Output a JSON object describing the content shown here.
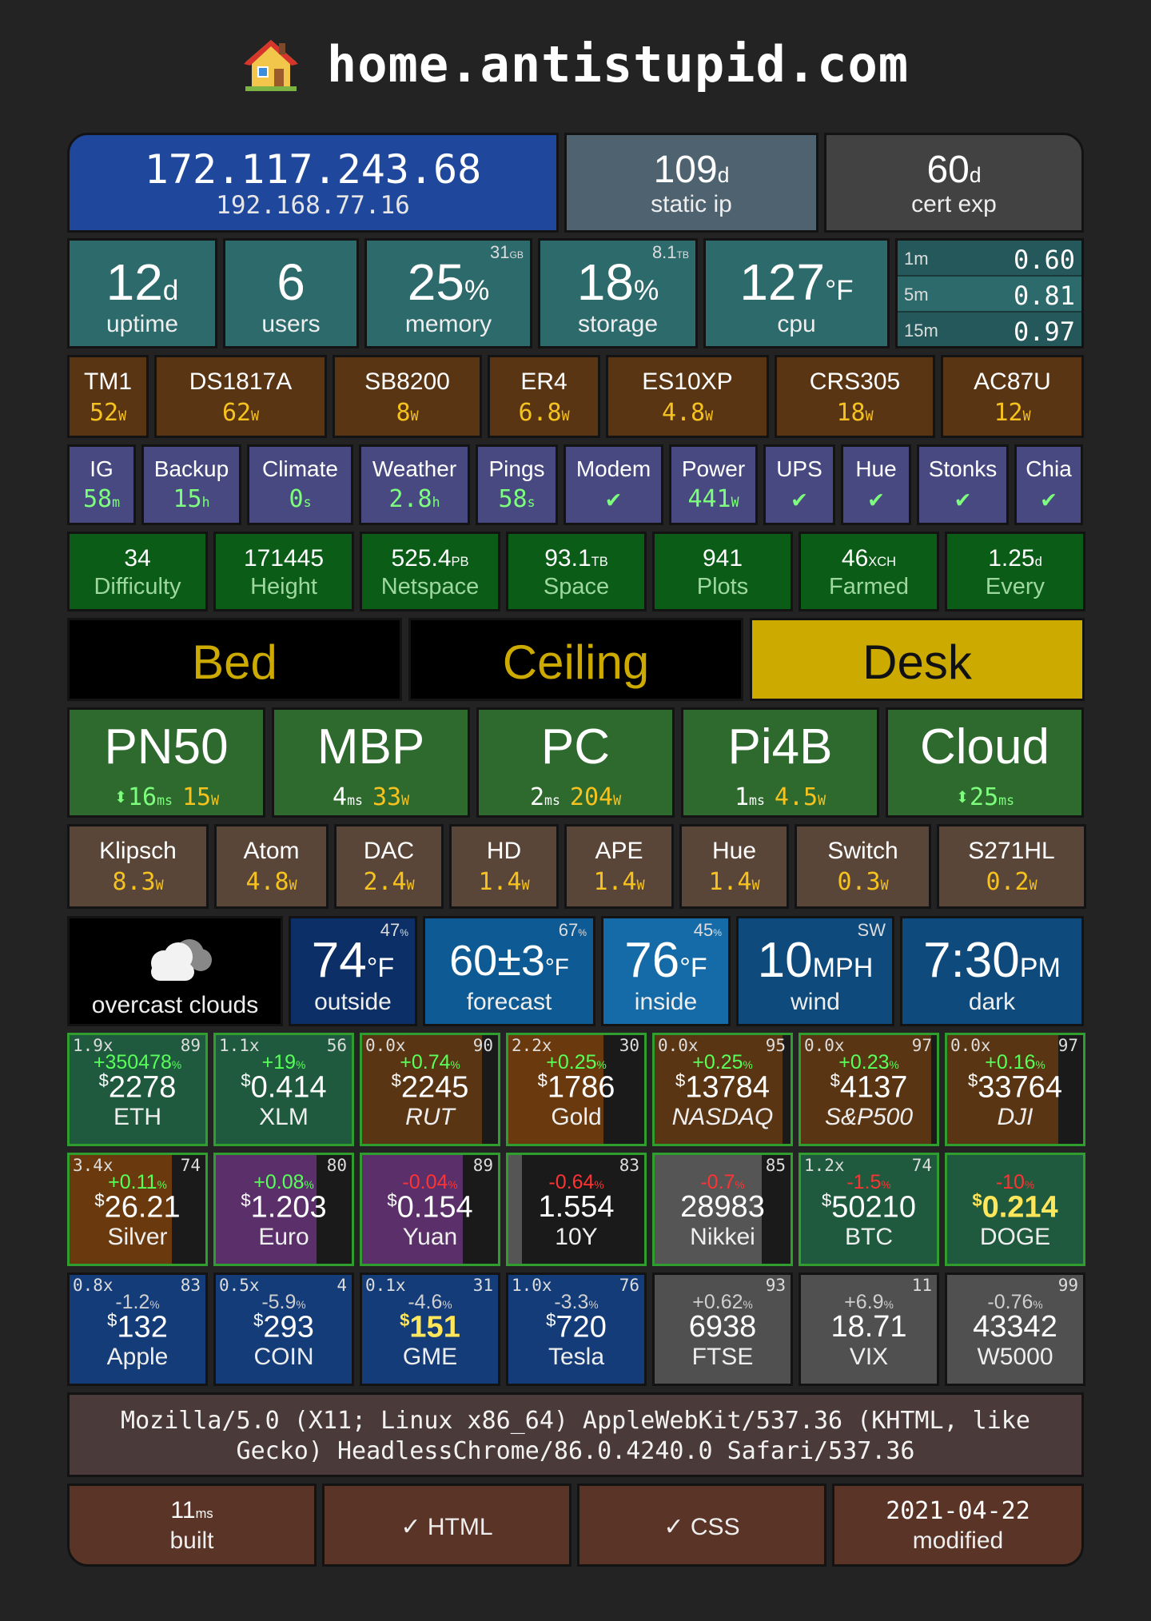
{
  "header": {
    "icon": "house-icon",
    "title": "home.antistupid.com"
  },
  "network": {
    "public_ip": "172.117.243.68",
    "local_ip": "192.168.77.16",
    "static_value": "109",
    "static_unit": "d",
    "static_label": "static ip",
    "cert_value": "60",
    "cert_unit": "d",
    "cert_label": "cert exp"
  },
  "system": {
    "uptime": {
      "value": "12",
      "unit": "d",
      "label": "uptime"
    },
    "users": {
      "value": "6",
      "label": "users"
    },
    "memory": {
      "value": "25",
      "unit": "%",
      "label": "memory",
      "total": "31",
      "total_unit": "GB"
    },
    "storage": {
      "value": "18",
      "unit": "%",
      "label": "storage",
      "total": "8.1",
      "total_unit": "TB"
    },
    "cpu": {
      "value": "127",
      "unit": "°F",
      "label": "cpu"
    },
    "load": [
      {
        "label": "1m",
        "value": "0.60"
      },
      {
        "label": "5m",
        "value": "0.81"
      },
      {
        "label": "15m",
        "value": "0.97"
      }
    ]
  },
  "devices": [
    {
      "name": "TM1",
      "value": "52",
      "unit": "W"
    },
    {
      "name": "DS1817A",
      "value": "62",
      "unit": "W"
    },
    {
      "name": "SB8200",
      "value": "8",
      "unit": "W"
    },
    {
      "name": "ER4",
      "value": "6.8",
      "unit": "W"
    },
    {
      "name": "ES10XP",
      "value": "4.8",
      "unit": "W"
    },
    {
      "name": "CRS305",
      "value": "18",
      "unit": "W"
    },
    {
      "name": "AC87U",
      "value": "12",
      "unit": "W"
    }
  ],
  "services": [
    {
      "name": "IG",
      "value": "58",
      "unit": "m"
    },
    {
      "name": "Backup",
      "value": "15",
      "unit": "h"
    },
    {
      "name": "Climate",
      "value": "0",
      "unit": "s"
    },
    {
      "name": "Weather",
      "value": "2.8",
      "unit": "h"
    },
    {
      "name": "Pings",
      "value": "58",
      "unit": "s"
    },
    {
      "name": "Modem",
      "value": "✔",
      "unit": ""
    },
    {
      "name": "Power",
      "value": "441",
      "unit": "W"
    },
    {
      "name": "UPS",
      "value": "✔",
      "unit": ""
    },
    {
      "name": "Hue",
      "value": "✔",
      "unit": ""
    },
    {
      "name": "Stonks",
      "value": "✔",
      "unit": ""
    },
    {
      "name": "Chia",
      "value": "✔",
      "unit": ""
    }
  ],
  "chia_stats": [
    {
      "value": "34",
      "unit": "",
      "label": "Difficulty"
    },
    {
      "value": "171445",
      "unit": "",
      "label": "Height"
    },
    {
      "value": "525.4",
      "unit": "PB",
      "label": "Netspace"
    },
    {
      "value": "93.1",
      "unit": "TB",
      "label": "Space"
    },
    {
      "value": "941",
      "unit": "",
      "label": "Plots"
    },
    {
      "value": "46",
      "unit": "XCH",
      "label": "Farmed"
    },
    {
      "value": "1.25",
      "unit": "d",
      "label": "Every"
    }
  ],
  "lights": [
    {
      "name": "Bed",
      "on": false
    },
    {
      "name": "Ceiling",
      "on": false
    },
    {
      "name": "Desk",
      "on": true
    }
  ],
  "hosts": [
    {
      "name": "PN50",
      "ping_prefix": "⬍",
      "ping": "16",
      "ping_unit": "ms",
      "power": "15",
      "power_unit": "W"
    },
    {
      "name": "MBP",
      "ping_prefix": "",
      "ping": "4",
      "ping_unit": "ms",
      "power": "33",
      "power_unit": "W"
    },
    {
      "name": "PC",
      "ping_prefix": "",
      "ping": "2",
      "ping_unit": "ms",
      "power": "204",
      "power_unit": "W"
    },
    {
      "name": "Pi4B",
      "ping_prefix": "",
      "ping": "1",
      "ping_unit": "ms",
      "power": "4.5",
      "power_unit": "W"
    },
    {
      "name": "Cloud",
      "ping_prefix": "⬍",
      "ping": "25",
      "ping_unit": "ms",
      "power": "",
      "power_unit": ""
    }
  ],
  "av_devices": [
    {
      "name": "Klipsch",
      "value": "8.3",
      "unit": "W"
    },
    {
      "name": "Atom",
      "value": "4.8",
      "unit": "W"
    },
    {
      "name": "DAC",
      "value": "2.4",
      "unit": "W"
    },
    {
      "name": "HD",
      "value": "1.4",
      "unit": "W"
    },
    {
      "name": "APE",
      "value": "1.4",
      "unit": "W"
    },
    {
      "name": "Hue",
      "value": "1.4",
      "unit": "W"
    },
    {
      "name": "Switch",
      "value": "0.3",
      "unit": "W"
    },
    {
      "name": "S271HL",
      "value": "0.2",
      "unit": "W"
    }
  ],
  "weather": {
    "condition": "overcast clouds",
    "icon": "cloud-icon",
    "outside": {
      "value": "74",
      "unit": "°F",
      "label": "outside",
      "humidity": "47"
    },
    "forecast": {
      "value": "60±3",
      "unit": "°F",
      "label": "forecast",
      "humidity": "67"
    },
    "inside": {
      "value": "76",
      "unit": "°F",
      "label": "inside",
      "humidity": "45"
    },
    "wind": {
      "value": "10",
      "unit": "MPH",
      "label": "wind",
      "direction": "SW"
    },
    "dark": {
      "value": "7:30",
      "unit": "PM",
      "label": "dark"
    }
  },
  "markets": [
    [
      {
        "name": "ETH",
        "price": "2278",
        "currency": "$",
        "change": "+350478",
        "dir": "up",
        "leverage": "1.9x",
        "score": "89",
        "italic": false,
        "bg": "#1f5a3e",
        "bar": 1.0
      },
      {
        "name": "XLM",
        "price": "0.414",
        "currency": "$",
        "change": "+19",
        "dir": "up",
        "leverage": "1.1x",
        "score": "56",
        "italic": false,
        "bg": "#1f5a3e",
        "bar": 1.0
      },
      {
        "name": "RUT",
        "price": "2245",
        "currency": "$",
        "change": "+0.74",
        "dir": "up",
        "leverage": "0.0x",
        "score": "90",
        "italic": true,
        "bg": "#5a3513",
        "bar": 0.88
      },
      {
        "name": "Gold",
        "price": "1786",
        "currency": "$",
        "change": "+0.25",
        "dir": "up",
        "leverage": "2.2x",
        "score": "30",
        "italic": false,
        "bg": "#6a3a0e",
        "bar": 0.7
      },
      {
        "name": "NASDAQ",
        "price": "13784",
        "currency": "$",
        "change": "+0.25",
        "dir": "up",
        "leverage": "0.0x",
        "score": "95",
        "italic": true,
        "bg": "#5a3513",
        "bar": 0.94
      },
      {
        "name": "S&P500",
        "price": "4137",
        "currency": "$",
        "change": "+0.23",
        "dir": "up",
        "leverage": "0.0x",
        "score": "97",
        "italic": true,
        "bg": "#5a3513",
        "bar": 0.96
      },
      {
        "name": "DJI",
        "price": "33764",
        "currency": "$",
        "change": "+0.16",
        "dir": "up",
        "leverage": "0.0x",
        "score": "97",
        "italic": true,
        "bg": "#5a3513",
        "bar": 0.82
      }
    ],
    [
      {
        "name": "Silver",
        "price": "26.21",
        "currency": "$",
        "change": "+0.11",
        "dir": "up",
        "leverage": "3.4x",
        "score": "74",
        "italic": false,
        "bg": "#6a3a0e",
        "bar": 0.75
      },
      {
        "name": "Euro",
        "price": "1.203",
        "currency": "$",
        "change": "+0.08",
        "dir": "up",
        "leverage": "",
        "score": "80",
        "italic": false,
        "bg": "#5a2f6a",
        "bar": 0.74
      },
      {
        "name": "Yuan",
        "price": "0.154",
        "currency": "$",
        "change": "-0.04",
        "dir": "down",
        "leverage": "",
        "score": "89",
        "italic": false,
        "bg": "#5a2f6a",
        "bar": 0.74
      },
      {
        "name": "10Y",
        "price": "1.554",
        "currency": "",
        "change": "-0.64",
        "dir": "down",
        "leverage": "",
        "score": "83",
        "italic": false,
        "bg": "#555555",
        "bar": 0.1
      },
      {
        "name": "Nikkei",
        "price": "28983",
        "currency": "",
        "change": "-0.7",
        "dir": "down",
        "leverage": "",
        "score": "85",
        "italic": false,
        "bg": "#555555",
        "bar": 0.79
      },
      {
        "name": "BTC",
        "price": "50210",
        "currency": "$",
        "change": "-1.5",
        "dir": "down",
        "leverage": "1.2x",
        "score": "74",
        "italic": false,
        "bg": "#1f5a3e",
        "bar": 1.0
      },
      {
        "name": "DOGE",
        "price": "0.214",
        "currency": "$",
        "change": "-10",
        "dir": "down",
        "leverage": "",
        "score": "",
        "italic": false,
        "bg": "#1f5a3e",
        "bar": 1.0,
        "highlight": true
      }
    ],
    [
      {
        "name": "Apple",
        "price": "132",
        "currency": "$",
        "change": "-1.2",
        "dir": "flat",
        "leverage": "0.8x",
        "score": "83",
        "italic": false,
        "bg": "#143c78",
        "bar": 1.0
      },
      {
        "name": "COIN",
        "price": "293",
        "currency": "$",
        "change": "-5.9",
        "dir": "flat",
        "leverage": "0.5x",
        "score": "4",
        "italic": false,
        "bg": "#143c78",
        "bar": 1.0
      },
      {
        "name": "GME",
        "price": "151",
        "currency": "$",
        "change": "-4.6",
        "dir": "flat",
        "leverage": "0.1x",
        "score": "31",
        "italic": false,
        "bg": "#143c78",
        "bar": 1.0,
        "highlight": true
      },
      {
        "name": "Tesla",
        "price": "720",
        "currency": "$",
        "change": "-3.3",
        "dir": "flat",
        "leverage": "1.0x",
        "score": "76",
        "italic": false,
        "bg": "#143c78",
        "bar": 1.0
      },
      {
        "name": "FTSE",
        "price": "6938",
        "currency": "",
        "change": "+0.62",
        "dir": "flat",
        "leverage": "",
        "score": "93",
        "italic": false,
        "bg": "#505050",
        "bar": 1.0
      },
      {
        "name": "VIX",
        "price": "18.71",
        "currency": "",
        "change": "+6.9",
        "dir": "flat",
        "leverage": "",
        "score": "11",
        "italic": false,
        "bg": "#505050",
        "bar": 1.0
      },
      {
        "name": "W5000",
        "price": "43342",
        "currency": "",
        "change": "-0.76",
        "dir": "flat",
        "leverage": "",
        "score": "99",
        "italic": false,
        "bg": "#505050",
        "bar": 1.0
      }
    ]
  ],
  "user_agent": "Mozilla/5.0 (X11; Linux x86_64) AppleWebKit/537.36 (KHTML, like Gecko) HeadlessChrome/86.0.4240.0 Safari/537.36",
  "footer": {
    "built_value": "11",
    "built_unit": "ms",
    "built_label": "built",
    "html_label": "✓ HTML",
    "css_label": "✓ CSS",
    "modified_value": "2021-04-22",
    "modified_label": "modified"
  },
  "colors": {
    "accent_yellow": "#f6c21f",
    "ok_green": "#7dff7d",
    "desk_on": "#ccaa00"
  }
}
